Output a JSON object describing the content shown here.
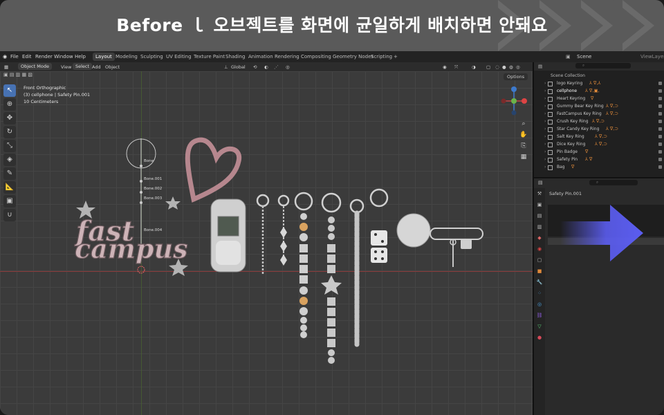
{
  "banner": {
    "title": "Before  ｌ  오브젝트를 화면에 균일하게 배치하면 안돼요"
  },
  "menubar": {
    "menus": [
      "File",
      "Edit",
      "Render",
      "Window",
      "Help"
    ],
    "workspaces": [
      "Layout",
      "Modeling",
      "Sculpting",
      "UV Editing",
      "Texture Paint",
      "Shading",
      "Animation",
      "Rendering",
      "Compositing",
      "Geometry Nodes",
      "Scripting"
    ],
    "active_workspace": "Layout",
    "add_tab": "+",
    "scene_label": "Scene",
    "viewlayer_label": "ViewLayer"
  },
  "viewport_header": {
    "mode": "Object Mode",
    "menus": [
      "View",
      "Select",
      "Add",
      "Object"
    ],
    "orientation": "Global"
  },
  "viewport": {
    "info_line1": "Front Orthographic",
    "info_line2": "(3) cellphone | Safety Pin.001",
    "info_line3": "10 Centimeters",
    "options_label": "Options",
    "bone_labels": [
      "Bone",
      "Bone.001",
      "Bone.002",
      "Bone.003",
      "Bone.004"
    ],
    "logo_line1": "fast",
    "logo_line2": "campus"
  },
  "outliner": {
    "title": "Scene Collection",
    "items": [
      {
        "label": "logo Keyring",
        "mods": "⅄ ∇,⅄"
      },
      {
        "label": "cellphone",
        "mods": "⅄ ∇,▣,"
      },
      {
        "label": "Heart Keyring",
        "mods": "∇"
      },
      {
        "label": "Gummy Bear Key Ring",
        "mods": "⅄ ∇,⊃"
      },
      {
        "label": "FastCampus Key Ring",
        "mods": "⅄ ∇,⊃"
      },
      {
        "label": "Crush Key Ring",
        "mods": "⅄ ∇,⊃"
      },
      {
        "label": "Star Candy Key Ring",
        "mods": "⅄ ∇,⊃"
      },
      {
        "label": "Salt Key Ring",
        "mods": "⅄ ∇,⊃"
      },
      {
        "label": "Dice Key Ring",
        "mods": "⅄ ∇,⊃"
      },
      {
        "label": "Pin Badge",
        "mods": "∇"
      },
      {
        "label": "Safety Pin",
        "mods": "⅄ ∇"
      },
      {
        "label": "Bag",
        "mods": "∇"
      }
    ]
  },
  "properties": {
    "object_name": "Safety Pin.001"
  },
  "colors": {
    "accent": "#4772b3",
    "arrow": "#5b5df0",
    "outliner_mods": "#e08a3a"
  }
}
